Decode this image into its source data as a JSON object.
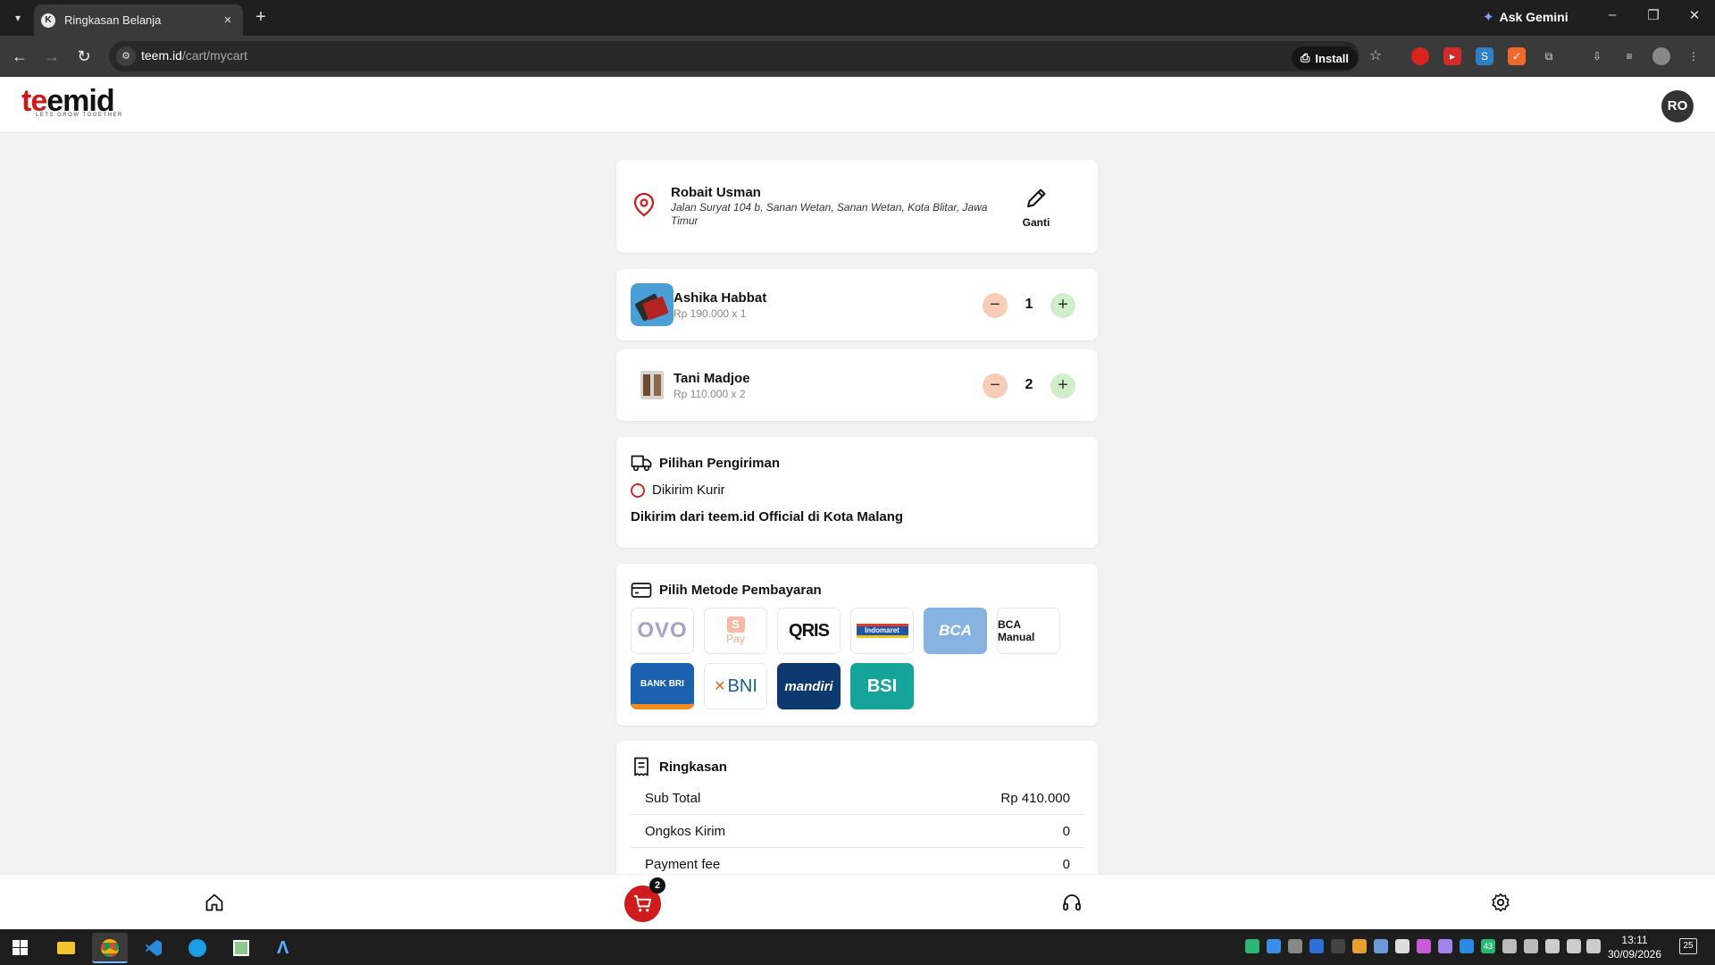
{
  "browser": {
    "tab_title": "Ringkasan Belanja",
    "ask_gemini": "Ask Gemini",
    "url_host": "teem.id",
    "url_path": "/cart/mycart",
    "install_label": "Install"
  },
  "header": {
    "logo_part1": "te",
    "logo_part2": "emid",
    "logo_tagline": "LETS GROW TOGETHER",
    "avatar_initials": "RO"
  },
  "address": {
    "name": "Robait Usman",
    "line": "Jalan Suryat 104 b, Sanan Wetan, Sanan Wetan, Kota Blitar, Jawa Timur",
    "edit_label": "Ganti"
  },
  "cart_items": [
    {
      "name": "Ashika Habbat",
      "price_line": "Rp 190.000 x 1",
      "qty": "1"
    },
    {
      "name": "Tani Madjoe",
      "price_line": "Rp 110.000 x 2",
      "qty": "2"
    }
  ],
  "shipping": {
    "title": "Pilihan Pengiriman",
    "option": "Dikirim Kurir",
    "from": "Dikirim dari teem.id Official di Kota Malang"
  },
  "payment": {
    "title": "Pilih Metode Pembayaran",
    "methods": [
      "OVO",
      "S",
      "Pay",
      "QRIS",
      "Indomaret",
      "BCA",
      "BCA Manual",
      "BANK BRI",
      "BNI",
      "mandiri",
      "BSI"
    ]
  },
  "summary": {
    "title": "Ringkasan",
    "rows": [
      {
        "label": "Sub Total",
        "value": "Rp 410.000"
      },
      {
        "label": "Ongkos Kirim",
        "value": "0"
      },
      {
        "label": "Payment fee",
        "value": "0"
      }
    ]
  },
  "bottom_nav": {
    "cart_badge": "2"
  },
  "taskbar": {
    "time": "13:11",
    "date": "30/09/2026",
    "notif_count": "25",
    "tray_num": "43"
  },
  "colors": {
    "accent_red": "#cf1b1b",
    "minus_bg": "#f7cdb8",
    "plus_bg": "#cfeec9",
    "page_bg": "#f2f2f2"
  }
}
